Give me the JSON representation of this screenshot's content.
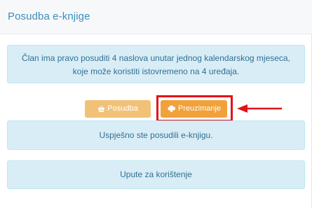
{
  "panel": {
    "title": "Posudba e-knjige"
  },
  "notice": {
    "line1": "Član ima pravo posuditi 4 naslova unutar jednog kalendarskog mjeseca,",
    "line2": "koje može koristiti istovremeno na 4 uređaja."
  },
  "buttons": {
    "borrow": {
      "label": "Posudba",
      "icon": "basket-icon"
    },
    "download": {
      "label": "Preuzimanje",
      "icon": "cloud-download-icon"
    }
  },
  "status": {
    "success_message": "Uspješno ste posudili e-knjigu."
  },
  "instructions": {
    "label": "Upute za korištenje"
  },
  "colors": {
    "title": "#3c8dbc",
    "info_bg": "#d9edf7",
    "info_text": "#31708f",
    "borrow_button": "#f2c178",
    "download_button": "#f0a13a",
    "highlight": "#e1131c"
  }
}
